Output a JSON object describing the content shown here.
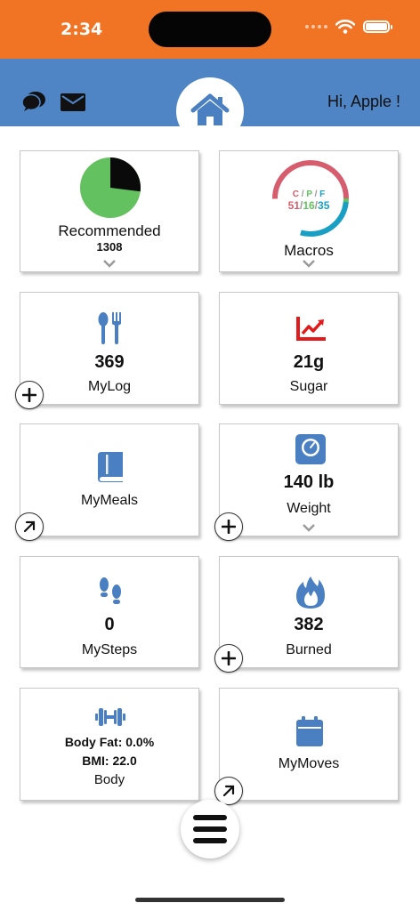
{
  "status_bar": {
    "time": "2:34"
  },
  "header": {
    "greeting": "Hi, Apple !",
    "icons": [
      "chat-icon",
      "mail-icon",
      "home-icon"
    ]
  },
  "colors": {
    "status_bar": "#f07424",
    "header": "#4f85c4",
    "icon_blue": "#4a7fc1",
    "sugar_red": "#e11b1b",
    "pie_green": "#63c15f"
  },
  "cards": {
    "recommended": {
      "label": "Recommended",
      "value": "1308",
      "pie_fraction_black": 0.27
    },
    "macros": {
      "label": "Macros",
      "c": "C",
      "p": "P",
      "f": "F",
      "sep": "/",
      "c_val": "51",
      "p_val": "16",
      "f_val": "35"
    },
    "mylog": {
      "label": "MyLog",
      "value": "369"
    },
    "sugar": {
      "label": "Sugar",
      "value": "21g"
    },
    "mymeals": {
      "label": "MyMeals"
    },
    "weight": {
      "label": "Weight",
      "value": "140 lb"
    },
    "mysteps": {
      "label": "MySteps",
      "value": "0"
    },
    "burned": {
      "label": "Burned",
      "value": "382"
    },
    "body": {
      "label": "Body",
      "body_fat": "Body Fat: 0.0%",
      "bmi": "BMI: 22.0"
    },
    "mymoves": {
      "label": "MyMoves"
    }
  }
}
